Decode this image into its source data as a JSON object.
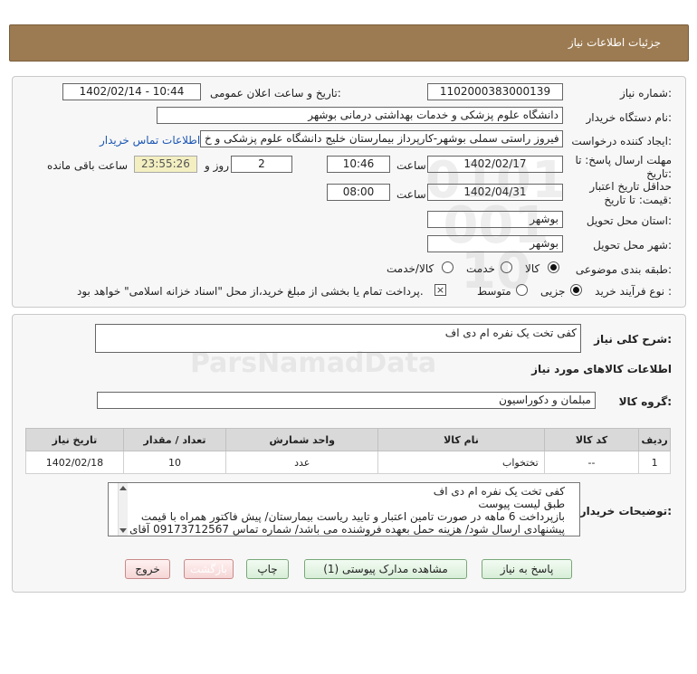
{
  "header": {
    "title": "جزئیات اطلاعات نیاز"
  },
  "form": {
    "need_number_label": "شماره نیاز:",
    "need_number": "1102000383000139",
    "announce_label": "تاریخ و ساعت اعلان عمومی:",
    "announce_value": "1402/02/14 - 10:44",
    "buyer_org_label": "نام دستگاه خریدار:",
    "buyer_org": "دانشگاه علوم پزشکی و خدمات بهداشتی درمانی بوشهر",
    "requester_label": "ایجاد کننده درخواست:",
    "requester": "فیروز راستی سملی بوشهر-کارپرداز بیمارستان خلیج دانشگاه علوم پزشکی و خ",
    "contact_link": "اطلاعات تماس خریدار",
    "deadline_label": "مهلت ارسال پاسخ: تا تاریخ:",
    "deadline_date": "1402/02/17",
    "time_label": "ساعت",
    "deadline_time": "10:46",
    "days_value": "2",
    "days_label": "روز و",
    "remaining_time": "23:55:26",
    "remaining_label": "ساعت باقی مانده",
    "validity_label": "حداقل تاریخ اعتبار قیمت: تا تاریخ:",
    "validity_date": "1402/04/31",
    "validity_time": "08:00",
    "province_label": "استان محل تحویل:",
    "province": "بوشهر",
    "city_label": "شهر محل تحویل:",
    "city": "بوشهر",
    "category_label": "طبقه بندی موضوعی:",
    "category_options": [
      "کالا",
      "خدمت",
      "کالا/خدمت"
    ],
    "category_selected": "کالا",
    "process_label": "نوع فرآیند خرید :",
    "process_options": [
      "جزیی",
      "متوسط"
    ],
    "process_selected": "جزیی",
    "payment_note": "پرداخت تمام یا بخشی از مبلغ خرید،از محل \"اسناد خزانه اسلامی\" خواهد بود."
  },
  "details": {
    "summary_label": "شرح کلی نیاز:",
    "summary": "کفی تخت یک نفره ام دی اف",
    "goods_info_title": "اطلاعات کالاهای مورد نیاز",
    "goods_group_label": "گروه کالا:",
    "goods_group": "مبلمان و دکوراسیون"
  },
  "table": {
    "headers": [
      "ردیف",
      "کد کالا",
      "نام کالا",
      "واحد شمارش",
      "تعداد / مقدار",
      "تاریخ نیاز"
    ],
    "rows": [
      [
        "1",
        "--",
        "تختخواب",
        "عدد",
        "10",
        "1402/02/18"
      ]
    ]
  },
  "buyer_notes": {
    "label": "توضیحات خریدار:",
    "lines": [
      "کفی تخت یک نفره ام دی اف",
      "طبق لیست پیوست",
      "بازپرداخت 6 ماهه در صورت تامین اعتبار و تایید ریاست بیمارستان/ پیش فاکتور همراه با قیمت",
      "پیشنهادی ارسال شود/ هزینه حمل بعهده فروشنده می باشد/ شماره تماس 09173712567 آقای"
    ]
  },
  "buttons": {
    "reply": "پاسخ به نیاز",
    "attachments": "مشاهده مدارک پیوستی (1)",
    "print": "چاپ",
    "back": "بازگشت",
    "exit": "خروج"
  },
  "colors": {
    "header_bar": "#9c7b52",
    "link": "#1b56b3",
    "button_green": "#d8eed8",
    "button_pink": "#f6d6d6"
  }
}
